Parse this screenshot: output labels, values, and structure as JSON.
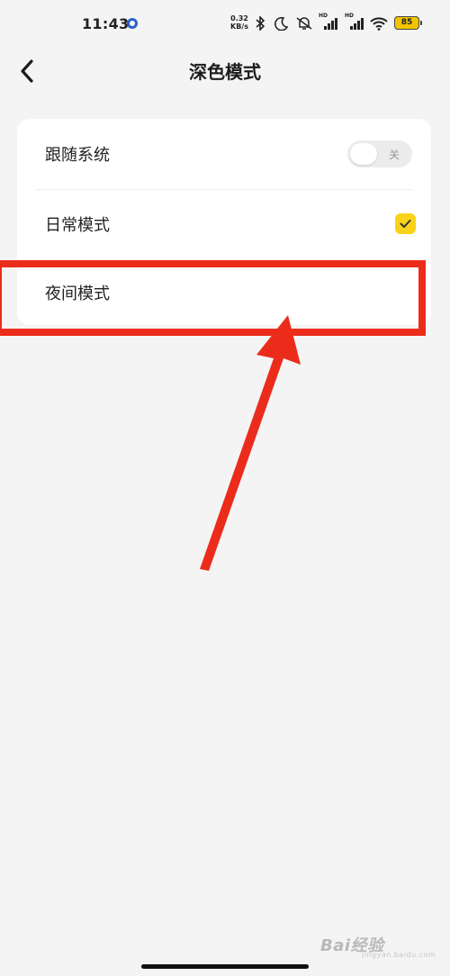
{
  "status_bar": {
    "time": "11:43",
    "net_speed_value": "0.32",
    "net_speed_unit": "KB/s",
    "signal_1_label": "HD",
    "signal_2_label": "HD",
    "battery_level": "85"
  },
  "header": {
    "back_icon": "chevron-left-icon",
    "title": "深色模式"
  },
  "settings": {
    "items": [
      {
        "label": "跟随系统",
        "control": "toggle",
        "toggle_text": "关",
        "on": false
      },
      {
        "label": "日常模式",
        "control": "check",
        "checked": true
      },
      {
        "label": "夜间模式",
        "control": "none",
        "highlighted": true
      }
    ]
  },
  "watermark": {
    "text": "Bai经验",
    "sub": "jingyan.baidu.com"
  },
  "colors": {
    "background": "#f5f4f4",
    "card": "#ffffff",
    "accent_yellow": "#f8d31a",
    "annotation_red": "#ec2c1b"
  }
}
